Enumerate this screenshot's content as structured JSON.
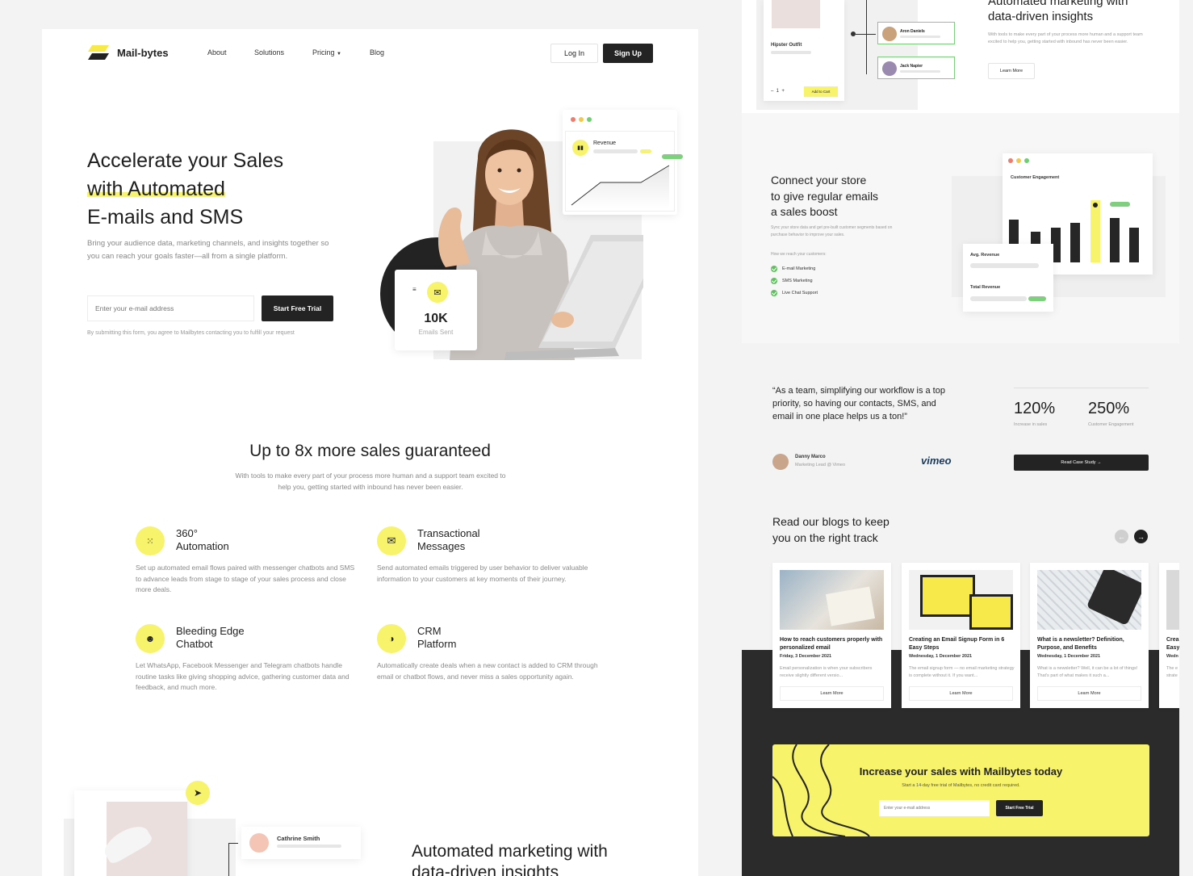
{
  "brand": {
    "name": "Mail-bytes"
  },
  "nav": {
    "items": [
      "About",
      "Solutions",
      "Pricing",
      "Blog"
    ],
    "login": "Log In",
    "signup": "Sign Up"
  },
  "hero": {
    "title_line1": "Accelerate your Sales",
    "title_line2": "with Automated",
    "title_line3": "E-mails and SMS",
    "description": "Bring your audience data, marketing channels, and insights together so you can reach your goals faster—all from a single platform.",
    "email_placeholder": "Enter your e-mail address",
    "cta": "Start Free Trial",
    "disclaimer": "By submitting this form, you agree to Mailbytes contacting you to fulfill your request",
    "revenue_label": "Revenue",
    "stat_value": "10K",
    "stat_label": "Emails Sent"
  },
  "sales": {
    "title": "Up to 8x more sales guaranteed",
    "subtitle": "With tools to make every part of your process more human and a support team excited to help you, getting started with inbound has never been easier."
  },
  "features": [
    {
      "title1": "360°",
      "title2": "Automation",
      "text": "Set up automated email flows paired with messenger chatbots and SMS to advance leads from stage to stage of your sales process and close more deals.",
      "icon": "automation-icon"
    },
    {
      "title1": "Transactional",
      "title2": "Messages",
      "text": "Send automated emails triggered by user behavior to deliver valuable information to your customers at key moments of their journey.",
      "icon": "envelope-icon"
    },
    {
      "title1": "Bleeding Edge",
      "title2": "Chatbot",
      "text": "Let WhatsApp, Facebook Messenger and Telegram chatbots handle routine tasks like giving shopping advice, gathering customer data and feedback, and much more.",
      "icon": "chatbot-icon"
    },
    {
      "title1": "CRM",
      "title2": "Platform",
      "text": "Automatically create deals when a new contact is added to CRM through email or chatbot flows, and never miss a sales opportunity again.",
      "icon": "crm-icon"
    }
  ],
  "automated": {
    "title_line1": "Automated marketing with",
    "title_line2": "data-driven insights",
    "description": "With tools to make every part of your process more human and a support team excited to help you, getting started with inbound has never been easier.",
    "learn_more": "Learn More",
    "contact_main": "Cathrine Smith",
    "contacts": [
      "Aron Daniels",
      "Jack Napier"
    ],
    "product_name": "Hipster Outfit",
    "qty": "1",
    "add_to_cart": "Add to Cart"
  },
  "store": {
    "title_line1": "Connect your store",
    "title_line2": "to give regular emails",
    "title_line3": "a sales boost",
    "description": "Sync your store data and get pre-built customer segments based on purchase behavior to improve your sales.",
    "reach_label": "How we reach your customers:",
    "channels": [
      "E-mail Marketing",
      "SMS Marketing",
      "Live Chat Support"
    ],
    "engagement_label": "Customer Engagement",
    "avg_revenue": "Avg. Revenue",
    "total_revenue": "Total Revenue"
  },
  "testimonial": {
    "quote": "“As a team, simplifying our workflow is a top priority, so having our contacts, SMS, and email in one place helps us a ton!”",
    "name": "Danny Marco",
    "role": "Marketing Lead @ Vimeo",
    "company": "vimeo",
    "stat1_value": "120%",
    "stat1_label": "Increase in sales",
    "stat2_value": "250%",
    "stat2_label": "Customer Engagement",
    "cta": "Read Case Study →"
  },
  "blogs": {
    "title_line1": "Read our blogs to keep",
    "title_line2": "you on the right track",
    "items": [
      {
        "title": "How to reach customers properly with personalized email",
        "date": "Friday, 3 December 2021",
        "excerpt": "Email personalization is when your subscribers receive slightly different versio...",
        "cta": "Learn More"
      },
      {
        "title": "Creating an Email Signup Form in 6 Easy Steps",
        "date": "Wednesday, 1 December 2021",
        "excerpt": "The email signup form — no email marketing strategy is complete without it. If you want...",
        "cta": "Learn More"
      },
      {
        "title": "What is a newsletter? Definition, Purpose, and Benefits",
        "date": "Wednesday, 1 December 2021",
        "excerpt": "What is a newsletter? Well, it can be a lot of things! That's part of what makes it such a...",
        "cta": "Learn More"
      },
      {
        "title": "Crea Easy",
        "date": "Wedn",
        "excerpt": "The e strate",
        "cta": ""
      }
    ]
  },
  "cta_banner": {
    "title": "Increase your sales with Mailbytes today",
    "subtitle": "Start a 14-day free trial of Mailbytes, no credit card required.",
    "email_placeholder": "Enter your e-mail address",
    "button": "Start Free Trial"
  },
  "colors": {
    "accent": "#f7f36a",
    "dark": "#2b2b2b",
    "green": "#5ec15e"
  }
}
